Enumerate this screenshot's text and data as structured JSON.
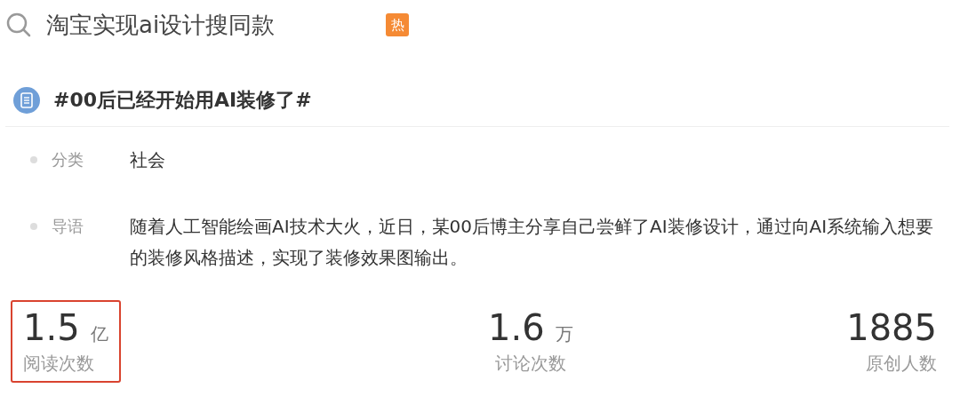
{
  "search": {
    "query": "淘宝实现ai设计搜同款",
    "badge": "热"
  },
  "topic": {
    "title": "#00后已经开始用AI装修了#"
  },
  "details": [
    {
      "label": "分类",
      "value": "社会"
    },
    {
      "label": "导语",
      "value": "随着人工智能绘画AI技术大火，近日，某00后博主分享自己尝鲜了AI装修设计，通过向AI系统输入想要的装修风格描述，实现了装修效果图输出。"
    }
  ],
  "stats": [
    {
      "number": "1.5",
      "unit": "亿",
      "label": "阅读次数",
      "highlighted": true
    },
    {
      "number": "1.6",
      "unit": "万",
      "label": "讨论次数",
      "highlighted": false
    },
    {
      "number": "1885",
      "label": "原创人数",
      "highlighted": false
    }
  ]
}
